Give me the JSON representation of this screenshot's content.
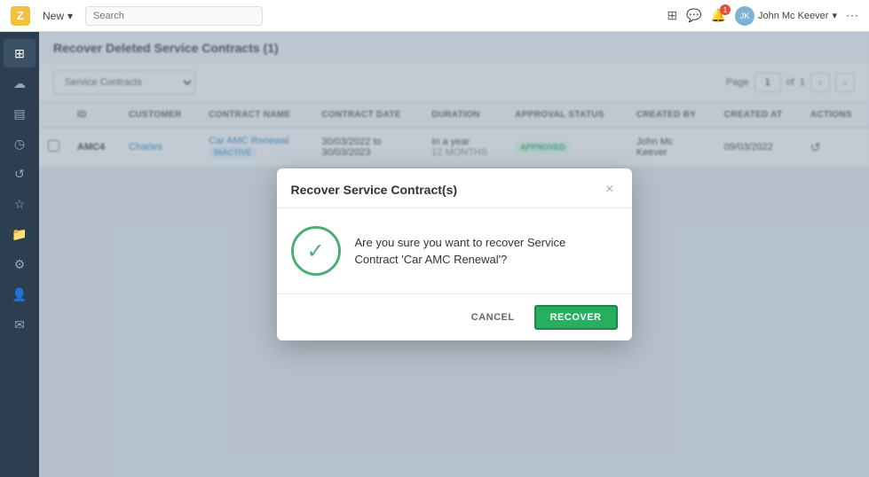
{
  "app": {
    "logo_letter": "Z",
    "new_btn": "New",
    "search_placeholder": "Search"
  },
  "topbar": {
    "user_name": "John Mc Keever",
    "notification_count": "1"
  },
  "sidebar": {
    "items": [
      {
        "icon": "⊞",
        "label": "grid-icon"
      },
      {
        "icon": "☁",
        "label": "cloud-icon"
      },
      {
        "icon": "▤",
        "label": "list-icon"
      },
      {
        "icon": "◷",
        "label": "clock-icon"
      },
      {
        "icon": "↺",
        "label": "refresh-icon"
      },
      {
        "icon": "☆",
        "label": "star-icon"
      },
      {
        "icon": "📁",
        "label": "folder-icon"
      },
      {
        "icon": "⚙",
        "label": "settings-icon"
      },
      {
        "icon": "👤",
        "label": "user-icon"
      },
      {
        "icon": "✉",
        "label": "message-icon"
      }
    ]
  },
  "page": {
    "title": "Recover Deleted Service Contracts (1)",
    "filter_options": [
      "Service Contracts"
    ],
    "filter_selected": "Service Contracts",
    "pagination": {
      "page_label": "Page",
      "current_page": "1",
      "separator": "of",
      "total_pages": "1"
    }
  },
  "table": {
    "columns": [
      "",
      "ID",
      "CUSTOMER",
      "CONTRACT NAME",
      "CONTRACT DATE",
      "DURATION",
      "APPROVAL STATUS",
      "CREATED BY",
      "CREATED AT",
      "ACTIONS"
    ],
    "rows": [
      {
        "checkbox": false,
        "id": "AMC4",
        "customer": "Charles",
        "contract_name": "Car AMC Renewal",
        "contract_date_start": "30/03/2022 to",
        "contract_date_end": "30/03/2023",
        "status_line1": "In a year",
        "status_line2": "12 MONTHS",
        "status_badge": "INACTIVE",
        "approval_badge": "APPROVED",
        "created_by_line1": "John Mc",
        "created_by_line2": "Keever",
        "created_at": "09/03/2022",
        "action_icon": "↺"
      }
    ]
  },
  "modal": {
    "title": "Recover Service Contract(s)",
    "message_line1": "Are you sure you want to recover Service",
    "message_line2": "Contract 'Car AMC Renewal'?",
    "cancel_label": "CANCEL",
    "recover_label": "RECOVER",
    "close_icon": "×",
    "check_icon": "✓"
  }
}
